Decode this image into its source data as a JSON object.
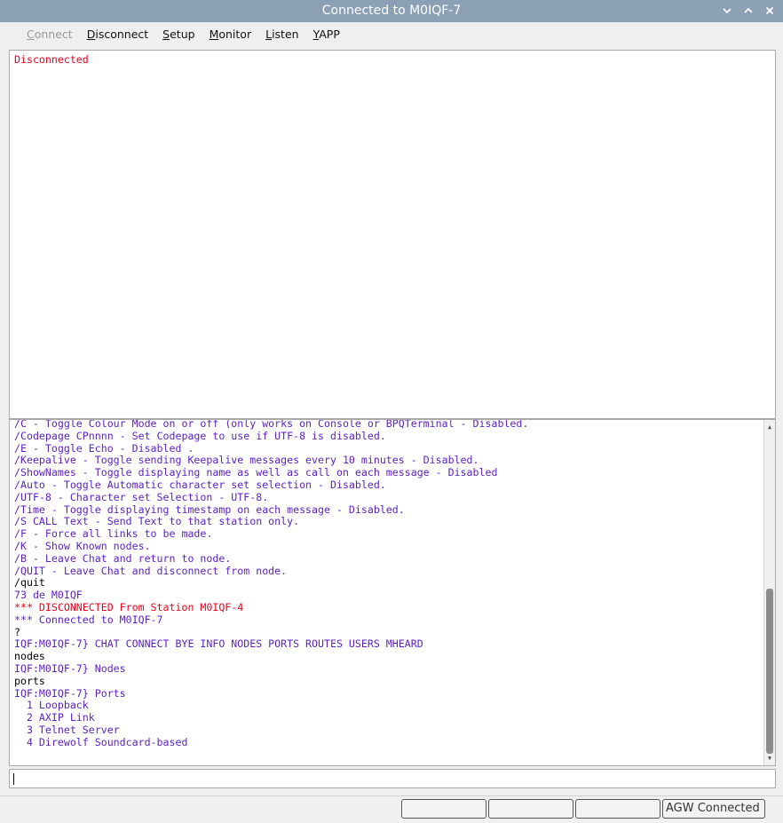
{
  "window": {
    "title": "Connected to M0IQF-7"
  },
  "menu": {
    "connect": {
      "first": "C",
      "rest": "onnect"
    },
    "disconnect": {
      "first": "D",
      "rest": "isconnect"
    },
    "setup": {
      "first": "S",
      "rest": "etup"
    },
    "monitor": {
      "first": "M",
      "rest": "onitor"
    },
    "listen": {
      "first": "L",
      "rest": "isten"
    },
    "yapp": {
      "first": "Y",
      "rest": "APP"
    }
  },
  "monitor_pane": {
    "text": "Disconnected"
  },
  "terminal_lines": [
    {
      "text": "/C - Toggle Colour Mode on or off (only works on Console or BPQTerminal - Disabled.",
      "color": "purple"
    },
    {
      "text": "/Codepage CPnnnn - Set Codepage to use if UTF-8 is disabled.",
      "color": "purple"
    },
    {
      "text": "/E - Toggle Echo - Disabled .",
      "color": "purple"
    },
    {
      "text": "/Keepalive - Toggle sending Keepalive messages every 10 minutes - Disabled.",
      "color": "purple"
    },
    {
      "text": "/ShowNames - Toggle displaying name as well as call on each message - Disabled",
      "color": "purple"
    },
    {
      "text": "/Auto - Toggle Automatic character set selection - Disabled.",
      "color": "purple"
    },
    {
      "text": "/UTF-8 - Character set Selection - UTF-8.",
      "color": "purple"
    },
    {
      "text": "/Time - Toggle displaying timestamp on each message - Disabled.",
      "color": "purple"
    },
    {
      "text": "/S CALL Text - Send Text to that station only.",
      "color": "purple"
    },
    {
      "text": "/F - Force all links to be made.",
      "color": "purple"
    },
    {
      "text": "/K - Show Known nodes.",
      "color": "purple"
    },
    {
      "text": "/B - Leave Chat and return to node.",
      "color": "purple"
    },
    {
      "text": "/QUIT - Leave Chat and disconnect from node.",
      "color": "purple"
    },
    {
      "text": "/quit",
      "color": "black"
    },
    {
      "text": "73 de M0IQF",
      "color": "purple"
    },
    {
      "text": "*** DISCONNECTED From Station M0IQF-4",
      "color": "red"
    },
    {
      "text": "*** Connected to M0IQF-7",
      "color": "purple"
    },
    {
      "text": "?",
      "color": "black"
    },
    {
      "text": "IQF:M0IQF-7} CHAT CONNECT BYE INFO NODES PORTS ROUTES USERS MHEARD",
      "color": "purple"
    },
    {
      "text": "nodes",
      "color": "black"
    },
    {
      "text": "IQF:M0IQF-7} Nodes",
      "color": "purple"
    },
    {
      "text": "ports",
      "color": "black"
    },
    {
      "text": "IQF:M0IQF-7} Ports",
      "color": "purple"
    },
    {
      "text": "  1 Loopback",
      "color": "purple"
    },
    {
      "text": "  2 AXIP Link",
      "color": "purple"
    },
    {
      "text": "  3 Telnet Server",
      "color": "purple"
    },
    {
      "text": "  4 Direwolf Soundcard-based",
      "color": "purple"
    }
  ],
  "input": {
    "value": ""
  },
  "status": {
    "cell1": "",
    "cell2": "",
    "cell3": "",
    "cell4": "AGW Connected"
  },
  "icons": {
    "minimize": "chevron-down-icon",
    "maximize": "chevron-up-icon",
    "close": "close-icon"
  },
  "colors": {
    "purple": "#5a1fc4",
    "red": "#e8001c",
    "titlebar": "#8b9fb5"
  }
}
